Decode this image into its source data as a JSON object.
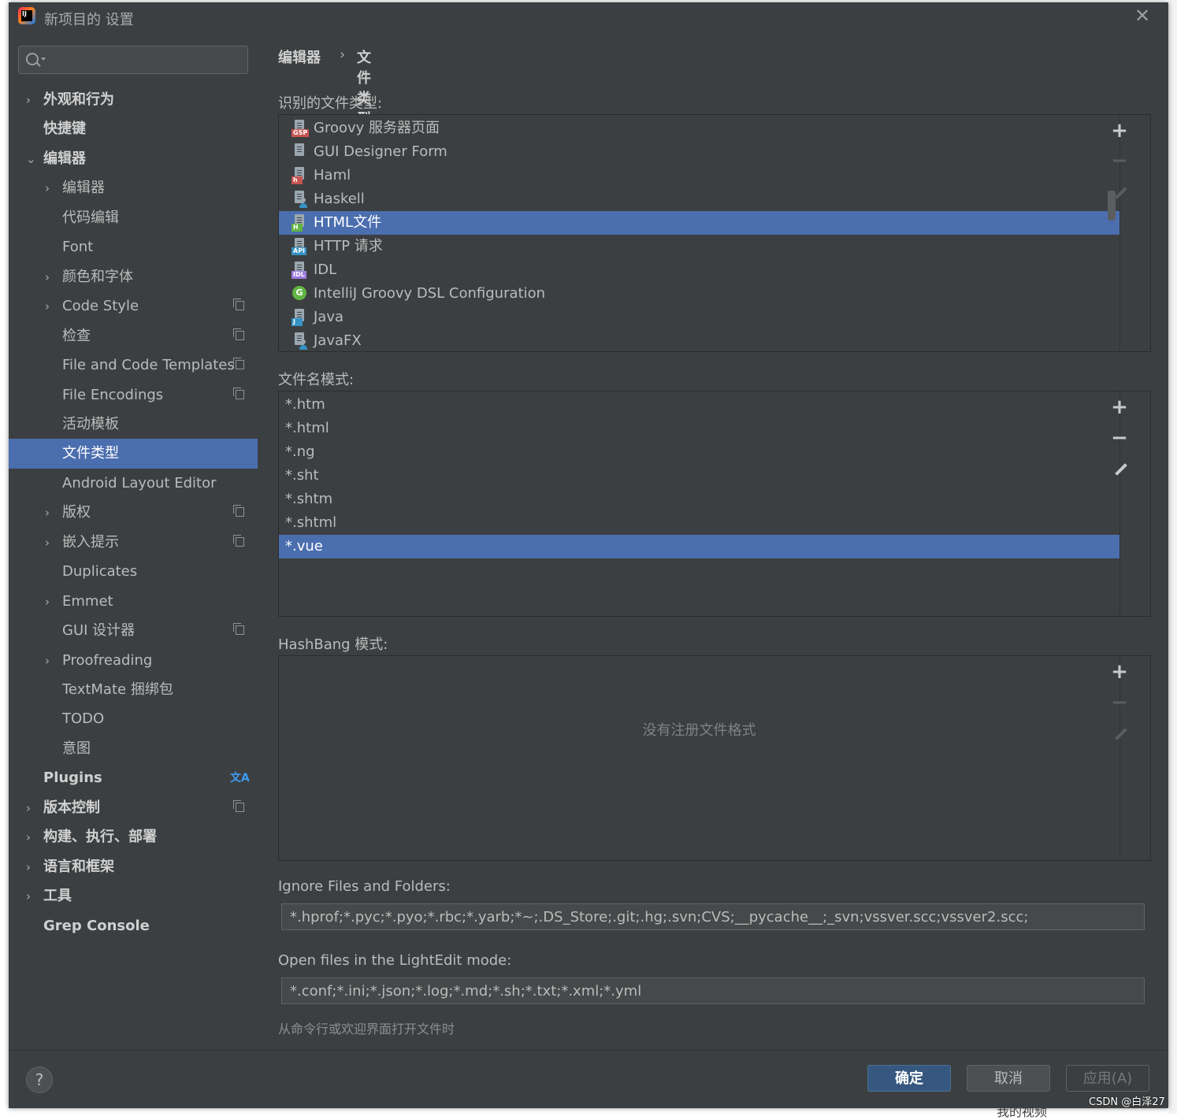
{
  "window": {
    "title": "新项目的 设置",
    "app_logo_text": "IJ",
    "close": "✕"
  },
  "sidebar": {
    "search": {
      "placeholder": ""
    },
    "items": [
      {
        "label": "外观和行为",
        "chevron": "›",
        "bold": true
      },
      {
        "label": "快捷键",
        "bold": true
      },
      {
        "label": "编辑器",
        "chevron": "⌄",
        "bold": true
      },
      {
        "label": "编辑器",
        "chevron": "›"
      },
      {
        "label": "代码编辑"
      },
      {
        "label": "Font"
      },
      {
        "label": "颜色和字体",
        "chevron": "›"
      },
      {
        "label": "Code Style",
        "chevron": "›",
        "icon": "copy-icon"
      },
      {
        "label": "检查",
        "icon": "copy-icon"
      },
      {
        "label": "File and Code Templates",
        "icon": "copy-icon"
      },
      {
        "label": "File Encodings",
        "icon": "copy-icon"
      },
      {
        "label": "活动模板"
      },
      {
        "label": "文件类型",
        "selected": true
      },
      {
        "label": "Android Layout Editor"
      },
      {
        "label": "版权",
        "chevron": "›",
        "icon": "copy-icon"
      },
      {
        "label": "嵌入提示",
        "chevron": "›",
        "icon": "copy-icon"
      },
      {
        "label": "Duplicates"
      },
      {
        "label": "Emmet",
        "chevron": "›"
      },
      {
        "label": "GUI 设计器",
        "icon": "copy-icon"
      },
      {
        "label": "Proofreading",
        "chevron": "›"
      },
      {
        "label": "TextMate 捆绑包"
      },
      {
        "label": "TODO"
      },
      {
        "label": "意图"
      },
      {
        "label": "Plugins",
        "bold": true,
        "icon": "translate-icon"
      },
      {
        "label": "版本控制",
        "chevron": "›",
        "bold": true,
        "icon": "copy-icon"
      },
      {
        "label": "构建、执行、部署",
        "chevron": "›",
        "bold": true
      },
      {
        "label": "语言和框架",
        "chevron": "›",
        "bold": true
      },
      {
        "label": "工具",
        "chevron": "›",
        "bold": true
      },
      {
        "label": "Grep Console",
        "bold": true
      }
    ],
    "translate_glyph": "文A"
  },
  "breadcrumb": {
    "parent": "编辑器",
    "separator": "›",
    "current": "文件类型"
  },
  "recognized": {
    "label": "识别的文件类型:",
    "items": [
      {
        "label": "Groovy 服务器页面",
        "tag": "GSP",
        "tag_color": "#c75450",
        "icon": "gsp-file-icon"
      },
      {
        "label": "GUI Designer Form",
        "icon": "form-file-icon"
      },
      {
        "label": "Haml",
        "tag": "h",
        "tag_color": "#c75450",
        "icon": "haml-file-icon"
      },
      {
        "label": "Haskell",
        "icon": "haskell-file-icon",
        "person": true
      },
      {
        "label": "HTML文件",
        "tag": "H",
        "tag_color": "#62b543",
        "icon": "html-file-icon",
        "selected": true
      },
      {
        "label": "HTTP 请求",
        "tag": "API",
        "tag_color": "#3592c4",
        "icon": "http-file-icon"
      },
      {
        "label": "IDL",
        "tag": "IDL",
        "tag_color": "#9e7ce0",
        "icon": "idl-file-icon"
      },
      {
        "label": "IntelliJ Groovy DSL Configuration",
        "icon": "groovy-dsl-icon",
        "circle": "G"
      },
      {
        "label": "Java",
        "tag": "J",
        "tag_color": "#3592c4",
        "icon": "java-file-icon"
      },
      {
        "label": "JavaFX",
        "icon": "javafx-file-icon",
        "person": true
      }
    ]
  },
  "patterns": {
    "label": "文件名模式:",
    "items": [
      {
        "label": "*.htm"
      },
      {
        "label": "*.html"
      },
      {
        "label": "*.ng"
      },
      {
        "label": "*.sht"
      },
      {
        "label": "*.shtm"
      },
      {
        "label": "*.shtml"
      },
      {
        "label": "*.vue",
        "selected": true
      }
    ]
  },
  "hashbang": {
    "label": "HashBang 模式:",
    "empty_text": "没有注册文件格式"
  },
  "toolbar": {
    "add": "+",
    "remove": "−"
  },
  "ignore": {
    "label": "Ignore Files and Folders:",
    "value": "*.hprof;*.pyc;*.pyo;*.rbc;*.yarb;*~;.DS_Store;.git;.hg;.svn;CVS;__pycache__;_svn;vssver.scc;vssver2.scc;"
  },
  "lightedit": {
    "label": "Open files in the LightEdit mode:",
    "value": "*.conf;*.ini;*.json;*.log;*.md;*.sh;*.txt;*.xml;*.yml",
    "hint": "从命令行或欢迎界面打开文件时"
  },
  "footer": {
    "help": "?",
    "ok": "确定",
    "cancel": "取消",
    "apply": "应用(A)"
  },
  "watermark": "CSDN @白泽27",
  "behind_text": "我的视频"
}
